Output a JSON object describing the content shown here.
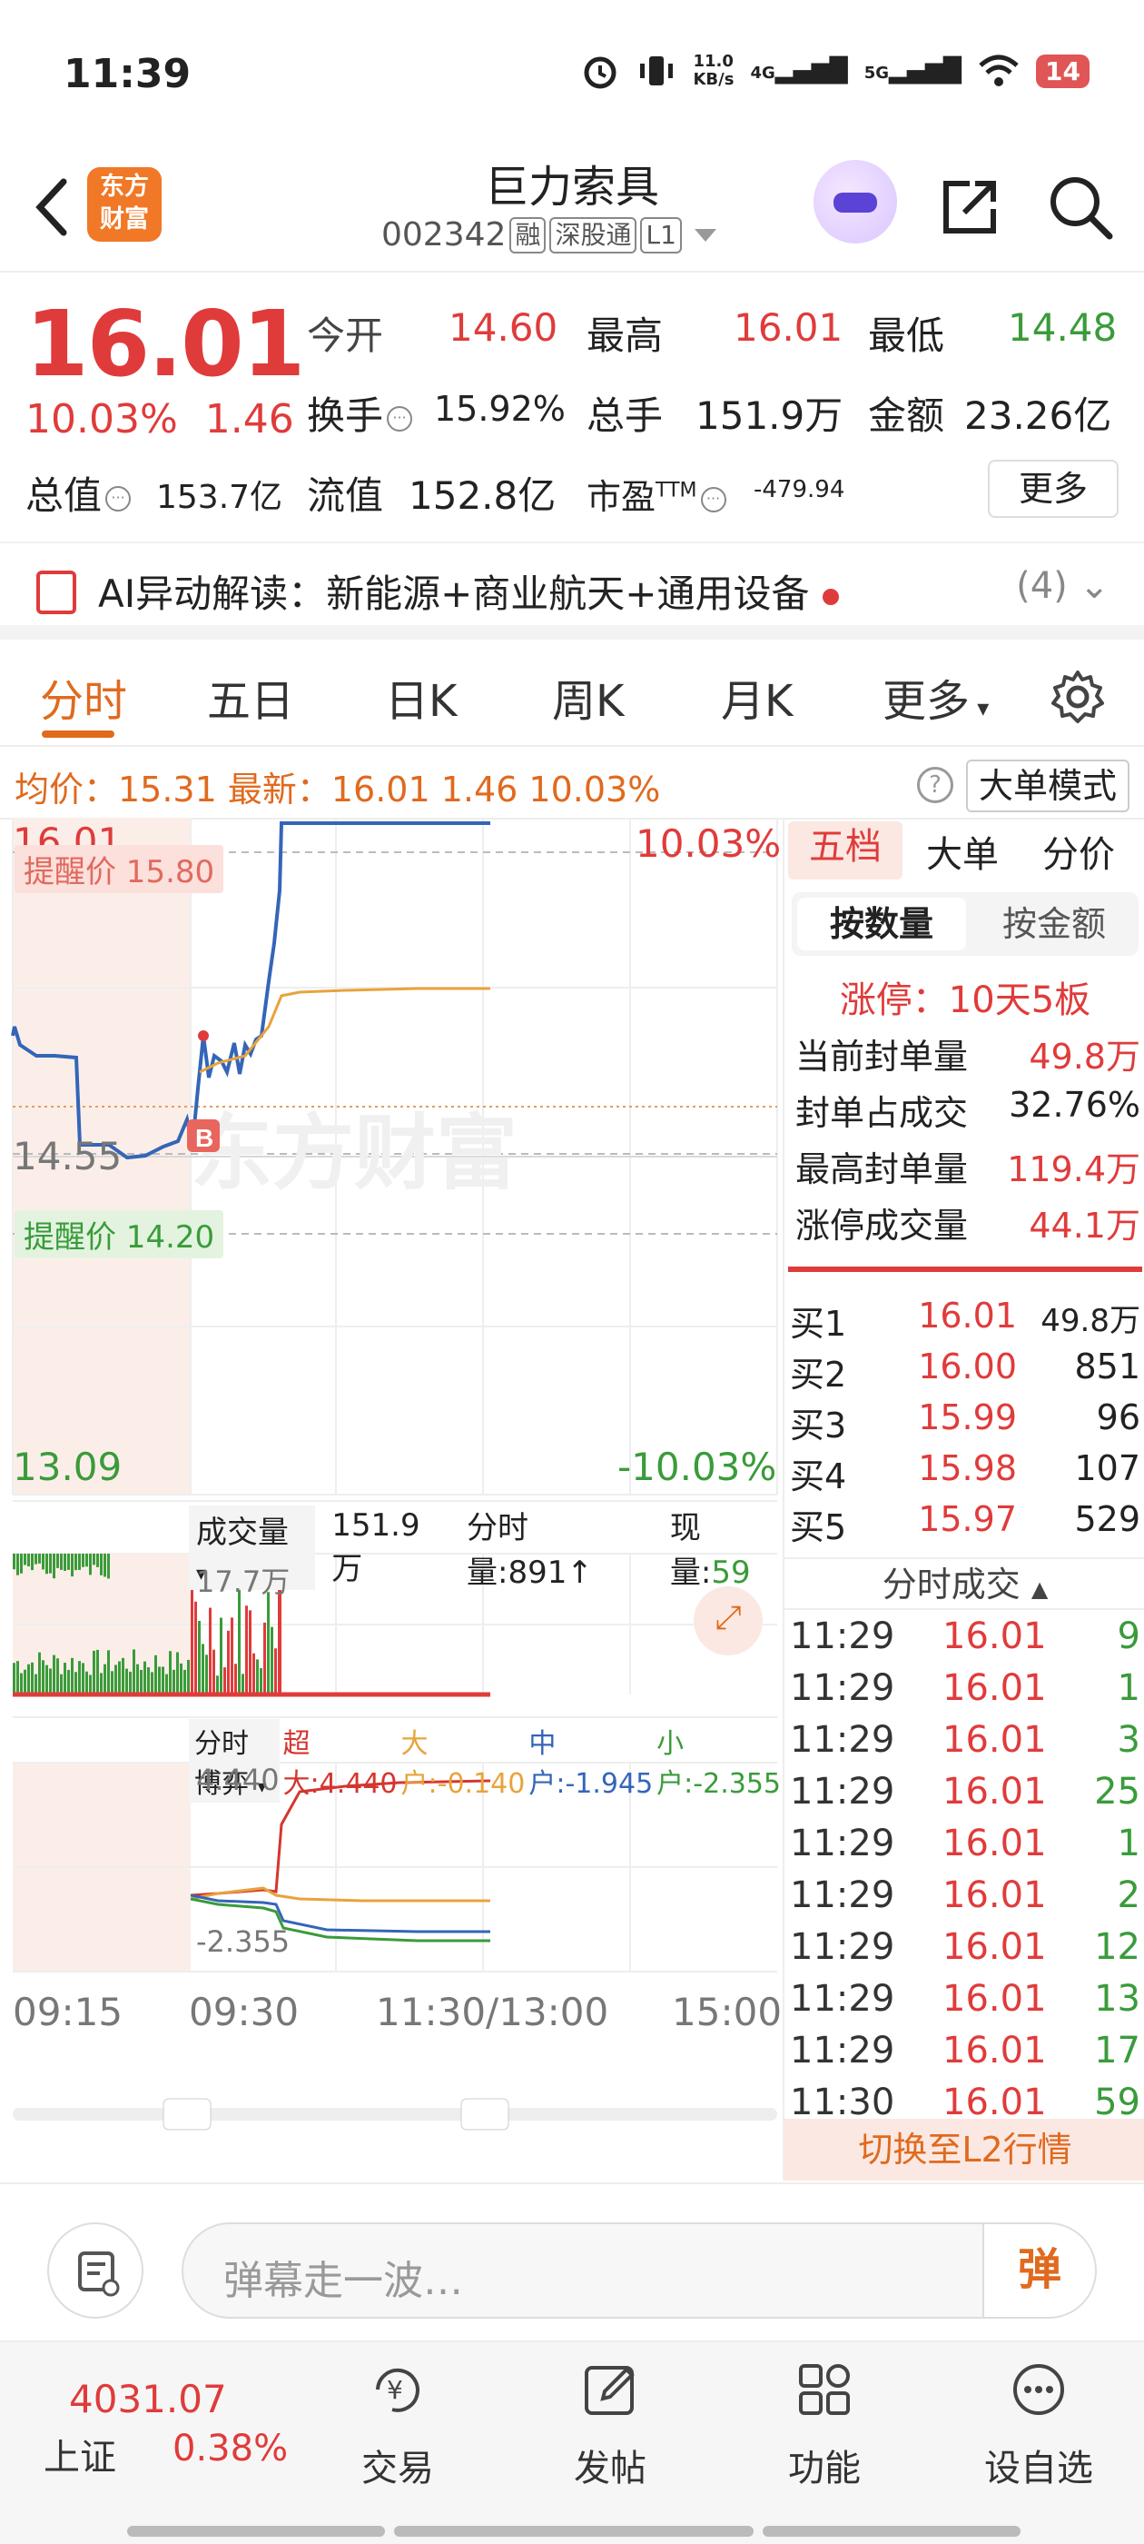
{
  "status": {
    "time": "11:39",
    "speed": "11.0\nKB/s",
    "net1": "4G",
    "net2": "5G",
    "battery": "14"
  },
  "header": {
    "name": "巨力索具",
    "code": "002342",
    "tags": [
      "融",
      "深股通",
      "L1"
    ],
    "logo_line1": "东方",
    "logo_line2": "财富"
  },
  "quote": {
    "price": "16.01",
    "pct": "10.03%",
    "chg": "1.46",
    "open_label": "今开",
    "open": "14.60",
    "high_label": "最高",
    "high": "16.01",
    "low_label": "最低",
    "low": "14.48",
    "turnover_label": "换手",
    "turnover": "15.92%",
    "volume_label": "总手",
    "volume": "151.9万",
    "amount_label": "金额",
    "amount": "23.26亿",
    "mcap_label": "总值",
    "mcap": "153.7亿",
    "float_label": "流值",
    "float": "152.8亿",
    "pe_label": "市盈",
    "pe_sup": "TTM",
    "pe": "-479.94",
    "more": "更多"
  },
  "ai": {
    "text": "AI异动解读：新能源+商业航天+通用设备",
    "count": "(4)"
  },
  "tabs": [
    "分时",
    "五日",
    "日K",
    "周K",
    "月K",
    "更多"
  ],
  "avgline": {
    "text": "均价：15.31 最新：16.01 1.46 10.03%",
    "mode": "大单模式"
  },
  "chart": {
    "price_top": "16.01",
    "price_mid": "14.55",
    "price_bot": "13.09",
    "pct_top": "10.03%",
    "pct_bot": "-10.03%",
    "remind_up": "提醒价 15.80",
    "remind_down": "提醒价 14.20",
    "watermark": "东方财富",
    "buy_marker": "B",
    "vol_sel": "成交量",
    "vol_total": "151.9万",
    "vol_min": "分时量:891↑",
    "vol_now_label": "现量:",
    "vol_now": "59",
    "vol_max": "17.7万",
    "game_sel": "分时博弈",
    "game_big": "超大:4.440",
    "game_large": "大户:-0.140",
    "game_mid": "中户:-1.945",
    "game_small": "小户:-2.355",
    "game_top": "4.440",
    "game_bot": "-2.355",
    "times": [
      "09:15",
      "09:30",
      "11:30/13:00",
      "15:00"
    ]
  },
  "panel": {
    "tabs": [
      "五档",
      "大单",
      "分价"
    ],
    "seg_on": "按数量",
    "seg_off": "按金额",
    "limit_title": "涨停：10天5板",
    "kv": [
      {
        "k": "当前封单量",
        "v": "49.8万"
      },
      {
        "k": "封单占成交",
        "v": "32.76%"
      },
      {
        "k": "最高封单量",
        "v": "119.4万"
      },
      {
        "k": "涨停成交量",
        "v": "44.1万"
      }
    ],
    "book": [
      {
        "n": "买1",
        "p": "16.01",
        "q": "49.8万"
      },
      {
        "n": "买2",
        "p": "16.00",
        "q": "851"
      },
      {
        "n": "买3",
        "p": "15.99",
        "q": "96"
      },
      {
        "n": "买4",
        "p": "15.98",
        "q": "107"
      },
      {
        "n": "买5",
        "p": "15.97",
        "q": "529"
      }
    ],
    "ticks_title": "分时成交",
    "ticks": [
      {
        "t": "11:29",
        "p": "16.01",
        "q": "9"
      },
      {
        "t": "11:29",
        "p": "16.01",
        "q": "1"
      },
      {
        "t": "11:29",
        "p": "16.01",
        "q": "3"
      },
      {
        "t": "11:29",
        "p": "16.01",
        "q": "25"
      },
      {
        "t": "11:29",
        "p": "16.01",
        "q": "1"
      },
      {
        "t": "11:29",
        "p": "16.01",
        "q": "2"
      },
      {
        "t": "11:29",
        "p": "16.01",
        "q": "12"
      },
      {
        "t": "11:29",
        "p": "16.01",
        "q": "13"
      },
      {
        "t": "11:29",
        "p": "16.01",
        "q": "17"
      },
      {
        "t": "11:30",
        "p": "16.01",
        "q": "59"
      }
    ],
    "l2": "切换至L2行情"
  },
  "comment": {
    "placeholder": "弹幕走一波…",
    "danmu": "弹"
  },
  "bottom": {
    "index_value": "4031.07",
    "index_name": "上证",
    "index_pct": "0.38%",
    "items": [
      "交易",
      "发帖",
      "功能",
      "设自选"
    ]
  },
  "colors": {
    "up": "#e03b3b",
    "down": "#3a9b3a",
    "accent": "#e06a1e",
    "price_line": "#3465b8",
    "avg_line": "#e8a33c"
  }
}
